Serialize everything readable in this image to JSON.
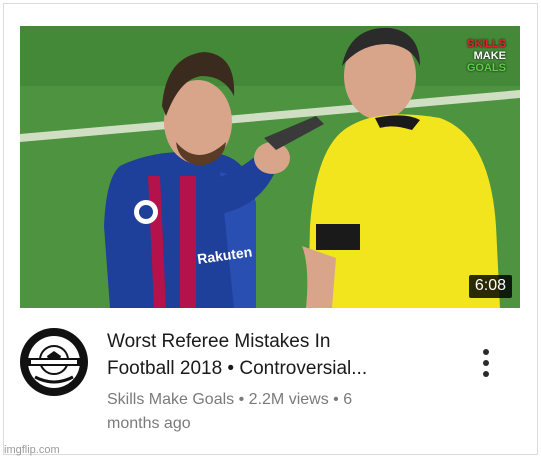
{
  "video": {
    "title_line1": "Worst Referee Mistakes In",
    "title_line2": "Football 2018 • Controversial...",
    "channel": "Skills Make Goals",
    "views": "2.2M views",
    "age_prefix": "6",
    "age_suffix": "months ago",
    "separator": "•",
    "duration": "6:08"
  },
  "thumbnail": {
    "watermark_line1": "SKILLS",
    "watermark_line2": "MAKE",
    "watermark_line3": "GOALS",
    "jersey_brand": "Rakuten"
  },
  "menu": {
    "icon": "more-vertical-icon"
  },
  "footer": {
    "watermark": "imgflip.com"
  },
  "colors": {
    "pitch": "#4a8f3a",
    "referee_shirt": "#f2e51e",
    "player_shirt_blue": "#1e3f9a",
    "player_shirt_red": "#b3124a",
    "title_text": "#1a1a1a",
    "meta_text": "#7a7a7a"
  }
}
